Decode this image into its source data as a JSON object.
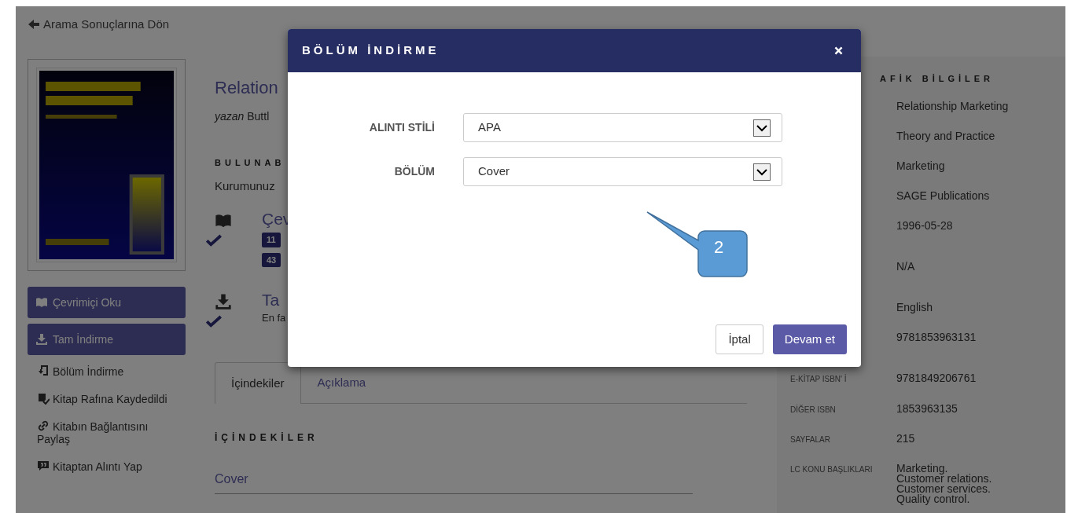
{
  "back_link": "Arama Sonuçlarına Dön",
  "sidebar": {
    "actions": [
      {
        "label": "Çevrimiçi Oku",
        "kind": "button"
      },
      {
        "label": "Tam İndirme",
        "kind": "button"
      },
      {
        "label": "Bölüm İndirme",
        "kind": "link"
      },
      {
        "label": "Kitap Rafına Kaydedildi",
        "kind": "link"
      },
      {
        "label": "Kitabın Bağlantısını Paylaş",
        "kind": "link"
      },
      {
        "label": "Kitaptan Alıntı Yap",
        "kind": "link"
      }
    ]
  },
  "book": {
    "title": "Relation",
    "byline_prefix": "yazan",
    "author": "Buttl",
    "availability_heading": "BULUNAB",
    "availability_text": "Kurumunuz",
    "options": [
      {
        "title": "Çev",
        "badges": [
          "11",
          "43"
        ],
        "checked": true
      },
      {
        "title": "Ta",
        "note": "En fa",
        "checked": true
      }
    ]
  },
  "tabs": [
    {
      "label": "İçindekiler",
      "selected": true
    },
    {
      "label": "Açıklama",
      "selected": false
    }
  ],
  "toc": {
    "heading": "İÇİNDEKİLER",
    "items": [
      "Cover"
    ]
  },
  "details": {
    "heading": "AFİK BİLGİLER",
    "rows": [
      {
        "values": [
          "Relationship Marketing"
        ]
      },
      {
        "values": [
          "Theory and Practice"
        ]
      },
      {
        "values": [
          "Marketing"
        ]
      },
      {
        "values": [
          "SAGE Publications"
        ]
      },
      {
        "values": [
          "1996-05-28"
        ]
      },
      {
        "values": [
          "N/A"
        ]
      },
      {
        "values": [
          "English"
        ]
      },
      {
        "values": [
          "9781853963131"
        ]
      },
      {
        "label": "E-KİTAP ISBN' İ",
        "values": [
          "9781849206761"
        ]
      },
      {
        "label": "DİĞER ISBN",
        "values": [
          "1853963135"
        ]
      },
      {
        "label": "SAYFALAR",
        "values": [
          "215"
        ]
      },
      {
        "label": "LC KONU BAŞLIKLARI",
        "values": [
          "Marketing.",
          "Customer relations.",
          "Customer services.",
          "Quality control."
        ]
      }
    ]
  },
  "modal": {
    "title": "BÖLÜM İNDİRME",
    "fields": [
      {
        "label": "ALINTI STİLİ",
        "value": "APA"
      },
      {
        "label": "BÖLÜM",
        "value": "Cover"
      }
    ],
    "callout": "2",
    "buttons": [
      {
        "label": "İptal",
        "kind": "secondary"
      },
      {
        "label": "Devam et",
        "kind": "primary"
      }
    ]
  }
}
